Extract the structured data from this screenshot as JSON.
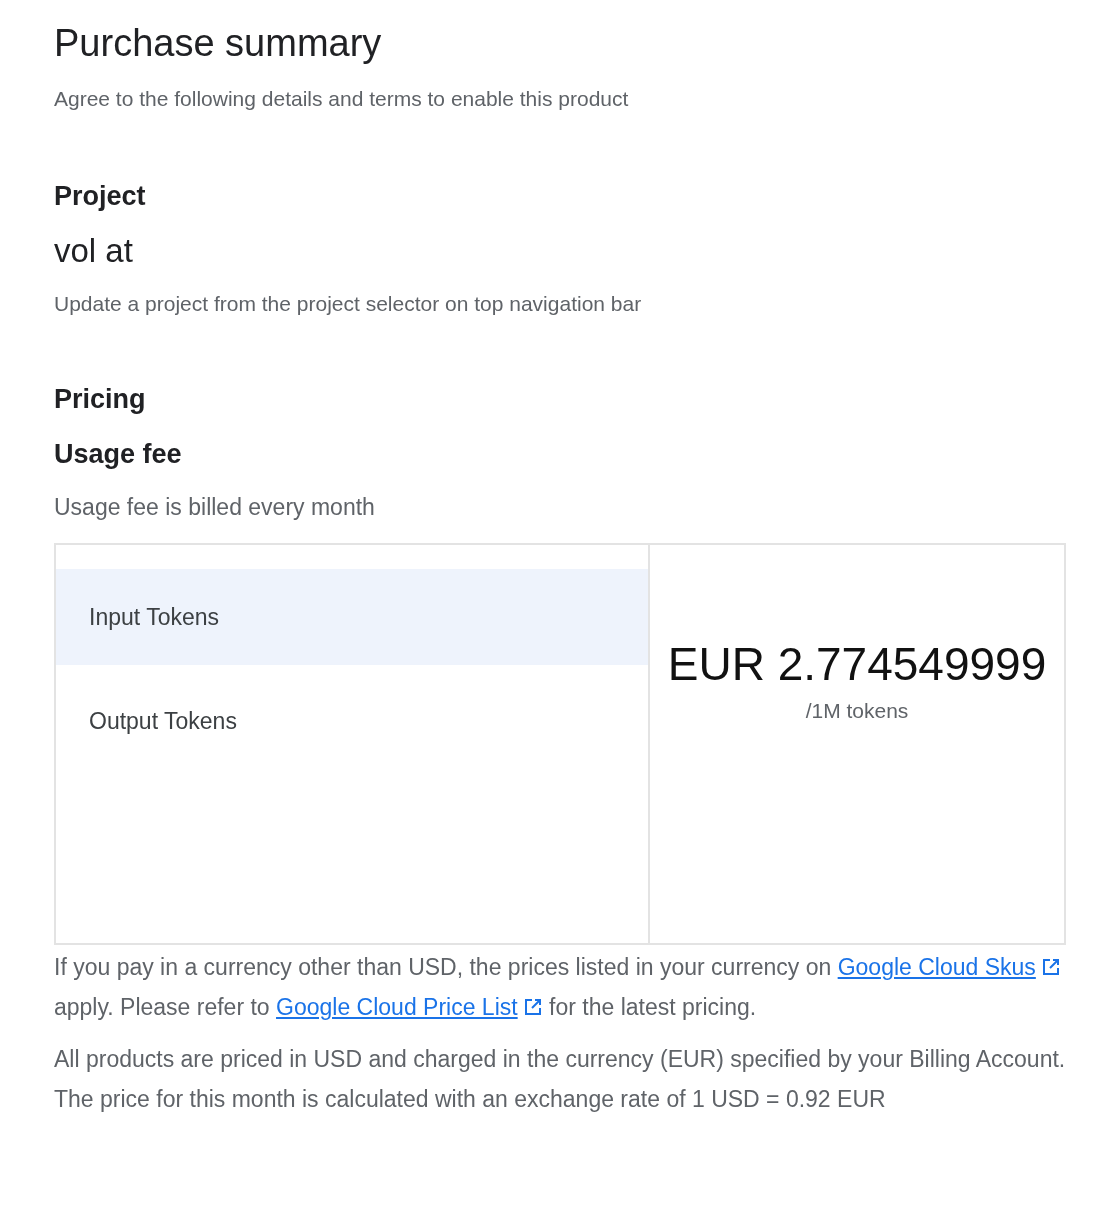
{
  "title": "Purchase summary",
  "subtitle": "Agree to the following details and terms to enable this product",
  "project": {
    "heading": "Project",
    "name": "vol at",
    "hint": "Update a project from the project selector on top navigation bar"
  },
  "pricing": {
    "heading": "Pricing",
    "fee_heading": "Usage fee",
    "fee_note": "Usage fee is billed every month",
    "rows": [
      {
        "label": "Input Tokens",
        "selected": true
      },
      {
        "label": "Output Tokens",
        "selected": false
      }
    ],
    "price": "EUR 2.774549999",
    "unit": "/1M tokens"
  },
  "notes": [
    {
      "parts": [
        {
          "text": "If you pay in a currency other than USD, the prices listed in your currency on "
        },
        {
          "link": "Google Cloud Skus"
        },
        {
          "text": " apply. Please refer to "
        },
        {
          "link": "Google Cloud Price List"
        },
        {
          "text": " for the latest pricing."
        }
      ]
    },
    {
      "parts": [
        {
          "text": "All products are priced in USD and charged in the currency (EUR) specified by your Billing Account. The price for this month is calculated with an exchange rate of 1 USD = 0.92 EUR"
        }
      ]
    }
  ]
}
